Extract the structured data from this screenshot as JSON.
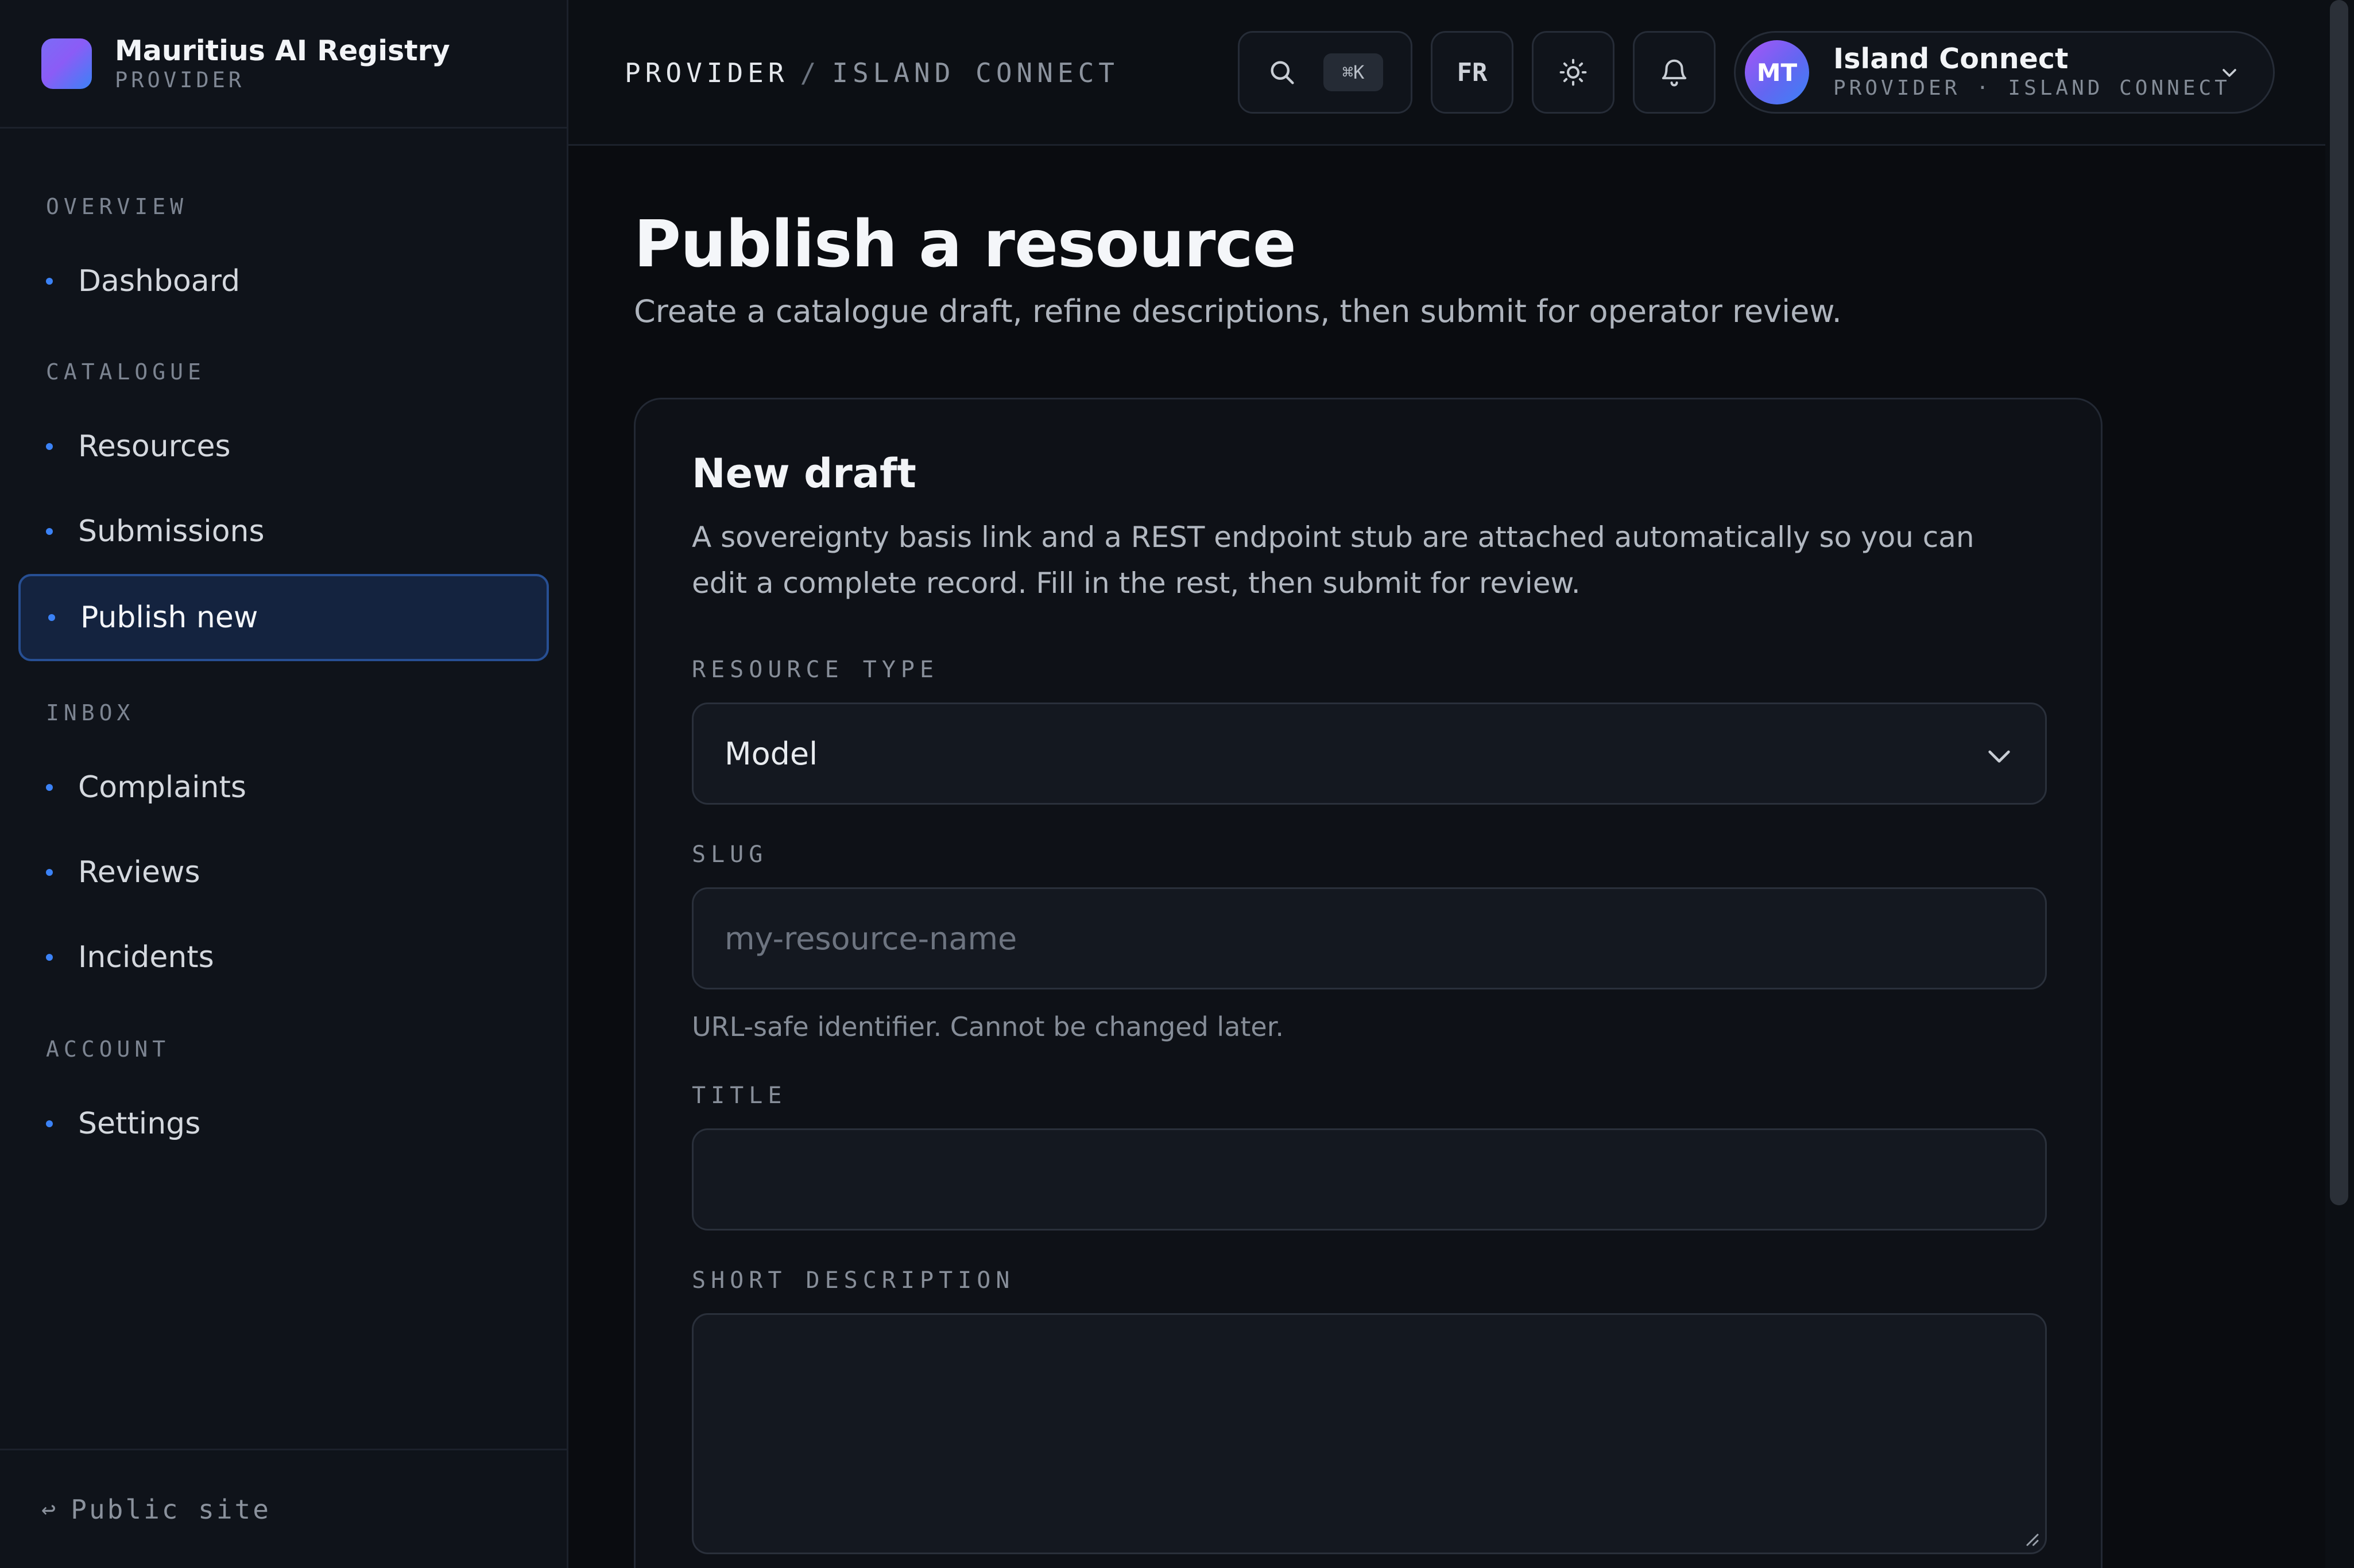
{
  "brand": {
    "name": "Mauritius AI Registry",
    "role": "PROVIDER"
  },
  "sidebar": {
    "sections": [
      {
        "label": "OVERVIEW",
        "items": [
          {
            "label": "Dashboard",
            "active": false
          }
        ]
      },
      {
        "label": "CATALOGUE",
        "items": [
          {
            "label": "Resources",
            "active": false
          },
          {
            "label": "Submissions",
            "active": false
          },
          {
            "label": "Publish new",
            "active": true
          }
        ]
      },
      {
        "label": "INBOX",
        "items": [
          {
            "label": "Complaints",
            "active": false
          },
          {
            "label": "Reviews",
            "active": false
          },
          {
            "label": "Incidents",
            "active": false
          }
        ]
      },
      {
        "label": "ACCOUNT",
        "items": [
          {
            "label": "Settings",
            "active": false
          }
        ]
      }
    ],
    "footer": {
      "arrow": "↩",
      "label": "Public site"
    }
  },
  "topbar": {
    "breadcrumb": {
      "first": "PROVIDER",
      "separator": "/",
      "second": "ISLAND CONNECT"
    },
    "search": {
      "icon": "search-icon",
      "shortcut": "⌘K"
    },
    "language": "FR",
    "theme_icon": "sun-icon",
    "notifications_icon": "bell-icon",
    "user": {
      "initials": "MT",
      "name": "Island Connect",
      "subtitle": "PROVIDER · ISLAND CONNECT"
    }
  },
  "main": {
    "title": "Publish a resource",
    "description": "Create a catalogue draft, refine descriptions, then submit for operator review.",
    "card": {
      "title": "New draft",
      "description": "A sovereignty basis link and a REST endpoint stub are attached automatically so you can edit a complete record. Fill in the rest, then submit for review.",
      "fields": {
        "resource_type": {
          "label": "RESOURCE TYPE",
          "value": "Model"
        },
        "slug": {
          "label": "SLUG",
          "value": "",
          "placeholder": "my-resource-name",
          "hint": "URL-safe identifier. Cannot be changed later."
        },
        "title": {
          "label": "TITLE",
          "value": ""
        },
        "short_description": {
          "label": "SHORT DESCRIPTION",
          "value": ""
        }
      }
    }
  },
  "colors": {
    "accent": "#3b82f6",
    "active_bg": "#14233f",
    "active_border": "#274f93",
    "background": "#0a0c10"
  }
}
